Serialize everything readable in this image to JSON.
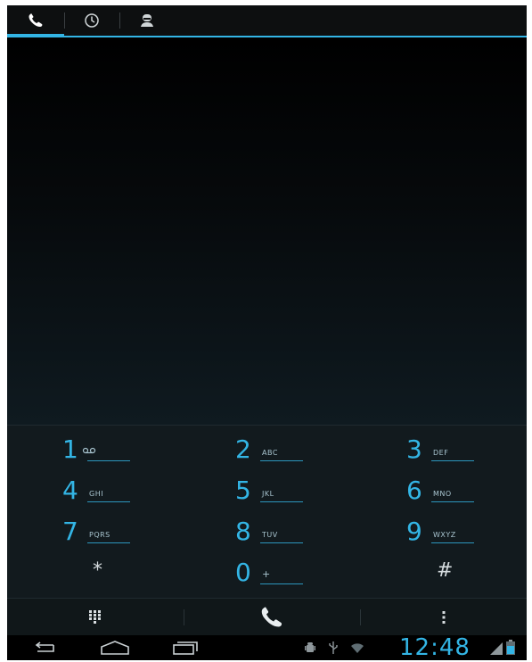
{
  "tabs": [
    {
      "name": "phone-tab",
      "icon": "phone-icon",
      "active": true
    },
    {
      "name": "call-log-tab",
      "icon": "clock-icon",
      "active": false
    },
    {
      "name": "contacts-tab",
      "icon": "person-icon",
      "active": false
    }
  ],
  "keypad": {
    "rows": [
      [
        {
          "digit": "1",
          "letters": "voicemail-icon"
        },
        {
          "digit": "2",
          "letters": "ABC"
        },
        {
          "digit": "3",
          "letters": "DEF"
        }
      ],
      [
        {
          "digit": "4",
          "letters": "GHI"
        },
        {
          "digit": "5",
          "letters": "JKL"
        },
        {
          "digit": "6",
          "letters": "MNO"
        }
      ],
      [
        {
          "digit": "7",
          "letters": "PQRS"
        },
        {
          "digit": "8",
          "letters": "TUV"
        },
        {
          "digit": "9",
          "letters": "WXYZ"
        }
      ],
      [
        {
          "digit": "*",
          "letters": ""
        },
        {
          "digit": "0",
          "letters": "+"
        },
        {
          "digit": "#",
          "letters": ""
        }
      ]
    ]
  },
  "actions": {
    "dialpad_icon": "dialpad-icon",
    "call_icon": "phone-call-icon",
    "menu_icon": "overflow-menu-icon"
  },
  "navbar": {
    "back_icon": "back-icon",
    "home_icon": "home-icon",
    "recents_icon": "recent-apps-icon"
  },
  "status": {
    "time": "12:48",
    "icons": [
      "android-debug-icon",
      "usb-icon",
      "wifi-icon",
      "signal-icon",
      "battery-icon"
    ]
  },
  "colors": {
    "accent": "#33b5e5",
    "background": "#000000",
    "keypad_bg": "#121a1e"
  }
}
